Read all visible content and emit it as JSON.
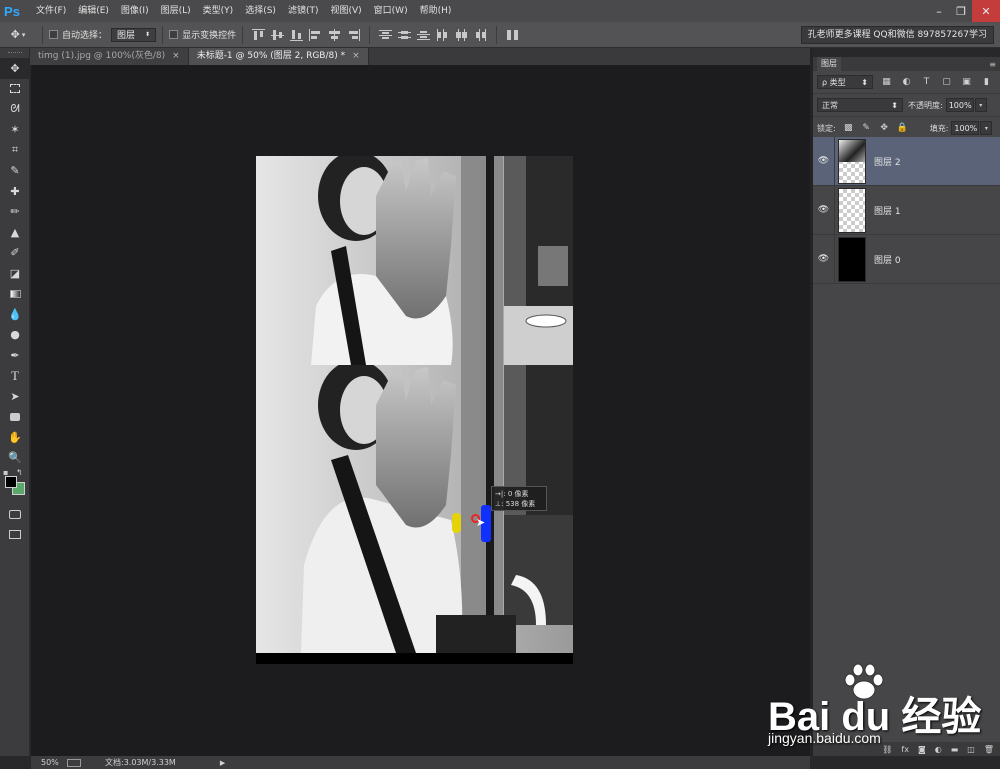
{
  "app": {
    "logo": "Ps"
  },
  "menu": [
    "文件(F)",
    "编辑(E)",
    "图像(I)",
    "图层(L)",
    "类型(Y)",
    "选择(S)",
    "滤镜(T)",
    "视图(V)",
    "窗口(W)",
    "帮助(H)"
  ],
  "window_controls": {
    "minimize": "–",
    "maximize": "❐",
    "close": "✕"
  },
  "options": {
    "tool_icon": "move-icon",
    "auto_select_label": "自动选择：",
    "auto_select_value": "图层",
    "show_transform_label": "显示变换控件",
    "workspace": "孔老师更多课程 QQ和微信 897857267学习"
  },
  "tabs": [
    {
      "label": "timg (1).jpg @ 100%(灰色/8)",
      "close": "×",
      "active": false
    },
    {
      "label": "未标题-1 @ 50% (图层 2, RGB/8) *",
      "close": "×",
      "active": true
    }
  ],
  "colors": {
    "foreground": "#000000",
    "background": "#5aa86a",
    "accent": "#31a8ff"
  },
  "measure_tooltip": {
    "line1": "0 像素",
    "line2": "538 像素",
    "icon1": "→|:",
    "icon2": "⊥:"
  },
  "status": {
    "zoom": "50%",
    "doc": "文档:3.03M/3.33M",
    "arrow": "▶"
  },
  "layers_panel": {
    "tab": "图层",
    "kind_filter": "ρ 类型",
    "blend_mode": "正常",
    "opacity_label": "不透明度:",
    "opacity_value": "100%",
    "lock_label": "锁定:",
    "fill_label": "填充:",
    "fill_value": "100%",
    "layers": [
      {
        "name": "图层 2",
        "selected": true,
        "thumb": "photo",
        "visible": true
      },
      {
        "name": "图层 1",
        "selected": false,
        "thumb": "transparent",
        "visible": true
      },
      {
        "name": "图层 0",
        "selected": false,
        "thumb": "black",
        "visible": true
      }
    ]
  },
  "watermark": {
    "text": "Bai du 经验",
    "sub": "jingyan.baidu.com"
  }
}
